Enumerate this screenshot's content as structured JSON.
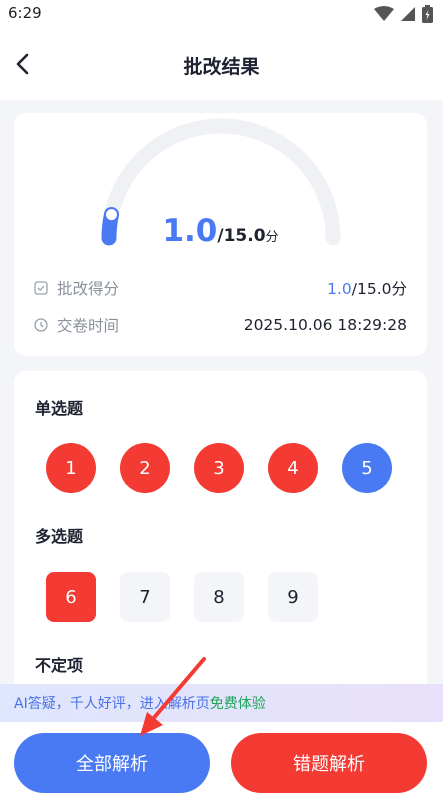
{
  "status_bar": {
    "time": "6:29"
  },
  "header": {
    "title": "批改结果"
  },
  "score": {
    "value": "1.0",
    "total": "/15.0",
    "unit": "分",
    "progress_fraction": 0.067
  },
  "info": {
    "score_label": "批改得分",
    "score_value": "1.0",
    "score_total": "/15.0分",
    "time_label": "交卷时间",
    "time_value": "2025.10.06 18:29:28"
  },
  "sections": {
    "single": {
      "title": "单选题",
      "items": [
        "1",
        "2",
        "3",
        "4",
        "5"
      ]
    },
    "multi": {
      "title": "多选题",
      "items": [
        "6",
        "7",
        "8",
        "9"
      ]
    },
    "indefinite": {
      "title": "不定项"
    }
  },
  "promo": {
    "text": "AI答疑，千人好评，进入解析页",
    "highlight": "免费体验"
  },
  "buttons": {
    "all": "全部解析",
    "wrong": "错题解析"
  },
  "colors": {
    "accent_blue": "#4a7af3",
    "wrong_red": "#f33a33",
    "promo_green": "#1ea55a"
  }
}
